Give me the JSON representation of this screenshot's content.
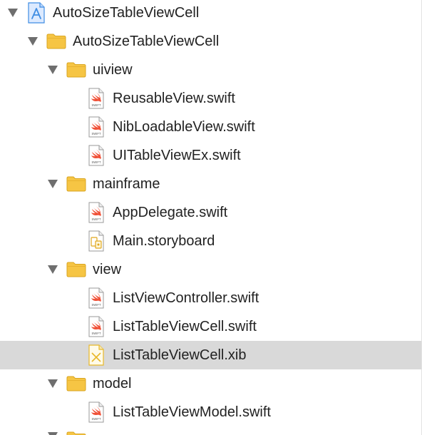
{
  "window": {
    "panel": "Project navigator"
  },
  "colors": {
    "selected_row": "#d9d9d9",
    "folder": "#f6c544",
    "swift_glyph": "#f05138",
    "project_icon": "#3f8de3",
    "xib_icon": "#e8b82a"
  },
  "tree": {
    "project": {
      "label": "AutoSizeTableViewCell",
      "icon": "xcode-project-icon",
      "expanded": true
    },
    "group_main": {
      "label": "AutoSizeTableViewCell",
      "icon": "folder-icon",
      "expanded": true
    },
    "group_uiview": {
      "label": "uiview",
      "icon": "folder-icon",
      "expanded": true,
      "files": [
        {
          "label": "ReusableView.swift",
          "icon": "swift-file-icon"
        },
        {
          "label": "NibLoadableView.swift",
          "icon": "swift-file-icon"
        },
        {
          "label": "UITableViewEx.swift",
          "icon": "swift-file-icon"
        }
      ]
    },
    "group_mainframe": {
      "label": "mainframe",
      "icon": "folder-icon",
      "expanded": true,
      "files": [
        {
          "label": "AppDelegate.swift",
          "icon": "swift-file-icon"
        },
        {
          "label": "Main.storyboard",
          "icon": "storyboard-file-icon"
        }
      ]
    },
    "group_view": {
      "label": "view",
      "icon": "folder-icon",
      "expanded": true,
      "files": [
        {
          "label": "ListViewController.swift",
          "icon": "swift-file-icon"
        },
        {
          "label": "ListTableViewCell.swift",
          "icon": "swift-file-icon"
        },
        {
          "label": "ListTableViewCell.xib",
          "icon": "xib-file-icon",
          "selected": true
        }
      ]
    },
    "group_model": {
      "label": "model",
      "icon": "folder-icon",
      "expanded": true,
      "files": [
        {
          "label": "ListTableViewModel.swift",
          "icon": "swift-file-icon"
        }
      ]
    }
  }
}
